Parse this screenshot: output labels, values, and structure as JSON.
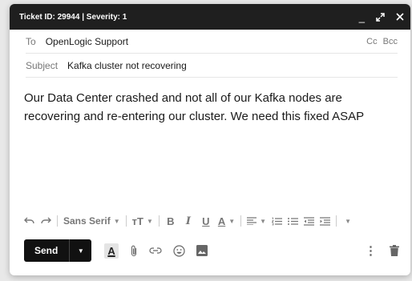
{
  "titlebar": {
    "title": "Ticket ID: 29944 | Severity: 1",
    "minimize_glyph": "_"
  },
  "to": {
    "label": "To",
    "value": "OpenLogic Support",
    "cc": "Cc",
    "bcc": "Bcc"
  },
  "subject": {
    "label": "Subject",
    "value": "Kafka cluster not recovering"
  },
  "message": {
    "body": "Our Data Center crashed and not all of our Kafka nodes are recovering and re-entering our cluster. We need this fixed ASAP"
  },
  "formatting": {
    "font_family": "Sans Serif",
    "font_size_glyph": "тT",
    "bold": "B",
    "italic": "I",
    "underline": "U",
    "text_color": "A",
    "dropdown_caret": "▼"
  },
  "footer": {
    "send_label": "Send",
    "send_caret": "▼",
    "text_color": "A",
    "more_glyph": "⋮"
  },
  "icons": [
    "undo-icon",
    "redo-icon",
    "align-icon",
    "numbered-list-icon",
    "bulleted-list-icon",
    "indent-less-icon",
    "indent-more-icon",
    "more-formatting-icon",
    "attach-icon",
    "link-icon",
    "emoji-icon",
    "photo-icon",
    "more-options-icon",
    "trash-icon",
    "minimize-icon",
    "expand-icon",
    "close-icon"
  ],
  "colors": {
    "titlebar": "#1f1f1f",
    "send": "#111111",
    "muted": "#777777"
  }
}
